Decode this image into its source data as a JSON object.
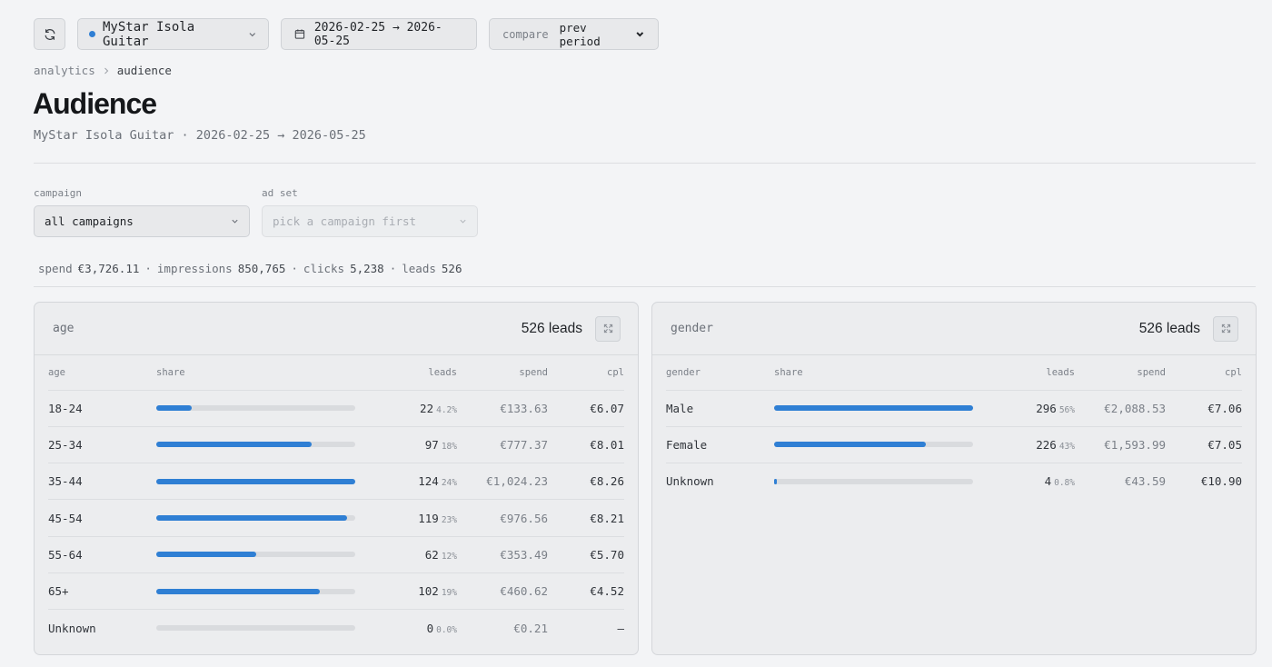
{
  "toolbar": {
    "account_label": "MyStar Isola Guitar",
    "date_range": "2026-02-25 → 2026-05-25",
    "compare_key": "compare",
    "compare_value": "prev period",
    "accent": "#2f7fd4"
  },
  "breadcrumb": {
    "parent": "analytics",
    "current": "audience"
  },
  "page": {
    "title": "Audience",
    "subtitle": "MyStar Isola Guitar · 2026-02-25 → 2026-05-25"
  },
  "filters": {
    "campaign_label": "campaign",
    "campaign_value": "all campaigns",
    "adset_label": "ad set",
    "adset_placeholder": "pick a campaign first"
  },
  "summary": {
    "spend_k": "spend",
    "spend_v": "€3,726.11",
    "impressions_k": "impressions",
    "impressions_v": "850,765",
    "clicks_k": "clicks",
    "clicks_v": "5,238",
    "leads_k": "leads",
    "leads_v": "526",
    "sep": "·"
  },
  "panels": [
    {
      "title": "age",
      "total": "526 leads",
      "headers": {
        "dim": "age",
        "share": "share",
        "leads": "leads",
        "spend": "spend",
        "cpl": "cpl"
      },
      "rows": [
        {
          "dim": "18-24",
          "share": 0.177,
          "leads": "22",
          "pct": "4.2%",
          "spend": "€133.63",
          "cpl": "€6.07"
        },
        {
          "dim": "25-34",
          "share": 0.782,
          "leads": "97",
          "pct": "18%",
          "spend": "€777.37",
          "cpl": "€8.01"
        },
        {
          "dim": "35-44",
          "share": 1.0,
          "leads": "124",
          "pct": "24%",
          "spend": "€1,024.23",
          "cpl": "€8.26"
        },
        {
          "dim": "45-54",
          "share": 0.96,
          "leads": "119",
          "pct": "23%",
          "spend": "€976.56",
          "cpl": "€8.21"
        },
        {
          "dim": "55-64",
          "share": 0.5,
          "leads": "62",
          "pct": "12%",
          "spend": "€353.49",
          "cpl": "€5.70"
        },
        {
          "dim": "65+",
          "share": 0.823,
          "leads": "102",
          "pct": "19%",
          "spend": "€460.62",
          "cpl": "€4.52"
        },
        {
          "dim": "Unknown",
          "share": 0.0,
          "leads": "0",
          "pct": "0.0%",
          "spend": "€0.21",
          "cpl": "—"
        }
      ]
    },
    {
      "title": "gender",
      "total": "526 leads",
      "headers": {
        "dim": "gender",
        "share": "share",
        "leads": "leads",
        "spend": "spend",
        "cpl": "cpl"
      },
      "rows": [
        {
          "dim": "Male",
          "share": 1.0,
          "leads": "296",
          "pct": "56%",
          "spend": "€2,088.53",
          "cpl": "€7.06"
        },
        {
          "dim": "Female",
          "share": 0.764,
          "leads": "226",
          "pct": "43%",
          "spend": "€1,593.99",
          "cpl": "€7.05"
        },
        {
          "dim": "Unknown",
          "share": 0.014,
          "leads": "4",
          "pct": "0.8%",
          "spend": "€43.59",
          "cpl": "€10.90"
        }
      ]
    }
  ]
}
